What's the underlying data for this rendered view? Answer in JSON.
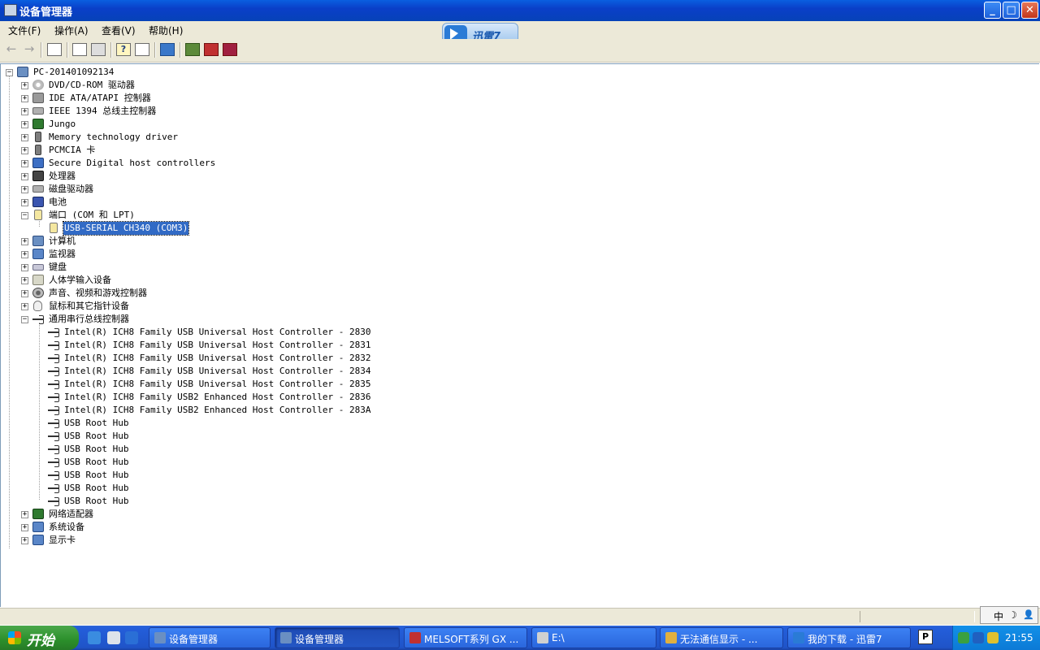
{
  "window": {
    "title": "设备管理器",
    "buttons": {
      "minimize": "_",
      "maximize": "□",
      "close": "✕"
    }
  },
  "menu": [
    {
      "label": "文件(F)"
    },
    {
      "label": "操作(A)"
    },
    {
      "label": "查看(V)"
    },
    {
      "label": "帮助(H)"
    }
  ],
  "thunder_badge": {
    "label": "迅雷7"
  },
  "toolbar": {
    "buttons": [
      {
        "name": "back-icon",
        "glyph": "←"
      },
      {
        "name": "forward-icon",
        "glyph": "→"
      },
      {
        "name": "show-hide-tree-icon"
      },
      {
        "name": "properties-icon"
      },
      {
        "name": "print-icon"
      },
      {
        "name": "help-icon",
        "glyph": "?"
      },
      {
        "name": "list-view-icon"
      },
      {
        "name": "scan-hardware-icon"
      },
      {
        "name": "update-driver-icon"
      },
      {
        "name": "uninstall-icon"
      },
      {
        "name": "disable-icon"
      }
    ]
  },
  "tree": {
    "root": "PC-201401092134",
    "categories": [
      {
        "label": "DVD/CD-ROM 驱动器",
        "icon": "disc-icon",
        "expanded": false
      },
      {
        "label": "IDE ATA/ATAPI 控制器",
        "icon": "ide-controller-icon",
        "expanded": false
      },
      {
        "label": "IEEE 1394 总线主控制器",
        "icon": "ieee1394-icon",
        "expanded": false
      },
      {
        "label": "Jungo",
        "icon": "chip-icon",
        "expanded": false
      },
      {
        "label": "Memory technology driver",
        "icon": "memory-card-icon",
        "expanded": false
      },
      {
        "label": "PCMCIA 卡",
        "icon": "pcmcia-icon",
        "expanded": false
      },
      {
        "label": "Secure Digital host controllers",
        "icon": "sd-host-icon",
        "expanded": false
      },
      {
        "label": "处理器",
        "icon": "processor-icon",
        "expanded": false
      },
      {
        "label": "磁盘驱动器",
        "icon": "disk-drive-icon",
        "expanded": false
      },
      {
        "label": "电池",
        "icon": "battery-icon",
        "expanded": false
      },
      {
        "label": "端口 (COM 和 LPT)",
        "icon": "port-icon",
        "expanded": true,
        "children": [
          {
            "label": "USB-SERIAL CH340 (COM3)",
            "icon": "port-icon",
            "selected": true
          }
        ]
      },
      {
        "label": "计算机",
        "icon": "computer-icon",
        "expanded": false
      },
      {
        "label": "监视器",
        "icon": "monitor-icon",
        "expanded": false
      },
      {
        "label": "键盘",
        "icon": "keyboard-icon",
        "expanded": false
      },
      {
        "label": "人体学输入设备",
        "icon": "hid-icon",
        "expanded": false
      },
      {
        "label": "声音、视频和游戏控制器",
        "icon": "sound-icon",
        "expanded": false
      },
      {
        "label": "鼠标和其它指针设备",
        "icon": "mouse-icon",
        "expanded": false
      },
      {
        "label": "通用串行总线控制器",
        "icon": "usb-icon",
        "expanded": true,
        "children": [
          {
            "label": "Intel(R) ICH8 Family USB Universal Host Controller - 2830",
            "icon": "usb-icon"
          },
          {
            "label": "Intel(R) ICH8 Family USB Universal Host Controller - 2831",
            "icon": "usb-icon"
          },
          {
            "label": "Intel(R) ICH8 Family USB Universal Host Controller - 2832",
            "icon": "usb-icon"
          },
          {
            "label": "Intel(R) ICH8 Family USB Universal Host Controller - 2834",
            "icon": "usb-icon"
          },
          {
            "label": "Intel(R) ICH8 Family USB Universal Host Controller - 2835",
            "icon": "usb-icon"
          },
          {
            "label": "Intel(R) ICH8 Family USB2 Enhanced Host Controller - 2836",
            "icon": "usb-icon"
          },
          {
            "label": "Intel(R) ICH8 Family USB2 Enhanced Host Controller - 283A",
            "icon": "usb-icon"
          },
          {
            "label": "USB Root Hub",
            "icon": "usb-icon"
          },
          {
            "label": "USB Root Hub",
            "icon": "usb-icon"
          },
          {
            "label": "USB Root Hub",
            "icon": "usb-icon"
          },
          {
            "label": "USB Root Hub",
            "icon": "usb-icon"
          },
          {
            "label": "USB Root Hub",
            "icon": "usb-icon"
          },
          {
            "label": "USB Root Hub",
            "icon": "usb-icon"
          },
          {
            "label": "USB Root Hub",
            "icon": "usb-icon"
          }
        ]
      },
      {
        "label": "网络适配器",
        "icon": "network-adapter-icon",
        "expanded": false
      },
      {
        "label": "系统设备",
        "icon": "system-devices-icon",
        "expanded": false
      },
      {
        "label": "显示卡",
        "icon": "display-adapter-icon",
        "expanded": false
      }
    ]
  },
  "ime": {
    "lang": "中",
    "moon": "☽",
    "user": "👤"
  },
  "taskbar": {
    "start": "开始",
    "tasks": [
      {
        "label": "设备管理器",
        "active": false,
        "icon_color": "#6a8fc2"
      },
      {
        "label": "设备管理器",
        "active": true,
        "icon_color": "#6a8fc2"
      },
      {
        "label": "MELSOFT系列 GX ...",
        "active": false,
        "icon_color": "#c03030"
      },
      {
        "label": "E:\\",
        "active": false,
        "icon_color": "#d0d0d0"
      },
      {
        "label": "无法通信显示 - ...",
        "active": false,
        "icon_color": "#e0b040"
      },
      {
        "label": "我的下载 - 迅雷7",
        "active": false,
        "icon_color": "#2a7bd6"
      }
    ],
    "p_button": "P",
    "clock": "21:55"
  }
}
